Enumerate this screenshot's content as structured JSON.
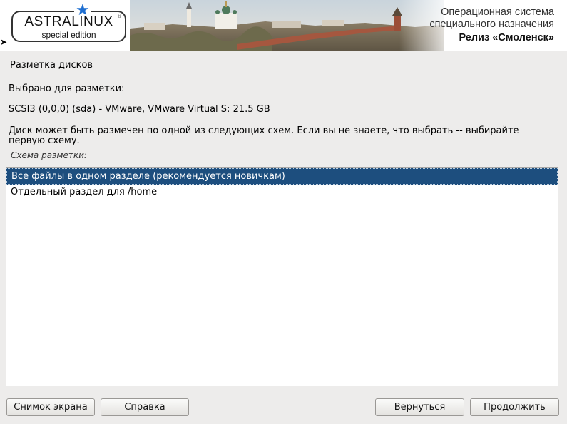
{
  "header": {
    "logo_title": "ASTRALINUX",
    "logo_reg": "®",
    "logo_subtitle": "special edition",
    "os_line1": "Операционная система",
    "os_line2": "специального назначения",
    "release": "Релиз «Смоленск»"
  },
  "page": {
    "title": "Разметка дисков",
    "selected_label": "Выбрано для разметки:",
    "disk_info": "SCSI3 (0,0,0) (sda) - VMware, VMware Virtual S: 21.5 GB",
    "description": "Диск может быть размечен по одной из следующих схем. Если вы не знаете, что выбрать -- выбирайте первую схему.",
    "scheme_label": "Схема разметки:"
  },
  "options": [
    {
      "label": "Все файлы в одном разделе (рекомендуется новичкам)",
      "selected": true
    },
    {
      "label": "Отдельный раздел для /home",
      "selected": false
    }
  ],
  "buttons": {
    "screenshot": "Снимок экрана",
    "help": "Справка",
    "back": "Вернуться",
    "continue": "Продолжить"
  },
  "colors": {
    "selection": "#1d4e7e",
    "logo_star": "#1f6fd1",
    "background": "#edeceb"
  }
}
